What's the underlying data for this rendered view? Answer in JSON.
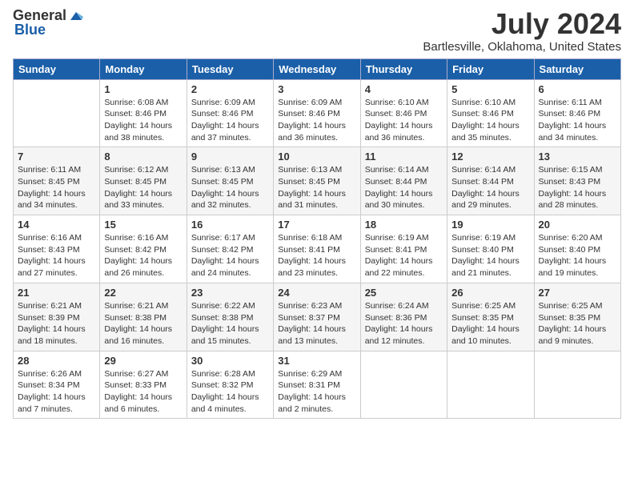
{
  "logo": {
    "general": "General",
    "blue": "Blue"
  },
  "title": {
    "month": "July 2024",
    "location": "Bartlesville, Oklahoma, United States"
  },
  "days_header": [
    "Sunday",
    "Monday",
    "Tuesday",
    "Wednesday",
    "Thursday",
    "Friday",
    "Saturday"
  ],
  "weeks": [
    [
      {
        "day": "",
        "sunrise": "",
        "sunset": "",
        "daylight": "",
        "empty": true
      },
      {
        "day": "1",
        "sunrise": "Sunrise: 6:08 AM",
        "sunset": "Sunset: 8:46 PM",
        "daylight": "Daylight: 14 hours and 38 minutes."
      },
      {
        "day": "2",
        "sunrise": "Sunrise: 6:09 AM",
        "sunset": "Sunset: 8:46 PM",
        "daylight": "Daylight: 14 hours and 37 minutes."
      },
      {
        "day": "3",
        "sunrise": "Sunrise: 6:09 AM",
        "sunset": "Sunset: 8:46 PM",
        "daylight": "Daylight: 14 hours and 36 minutes."
      },
      {
        "day": "4",
        "sunrise": "Sunrise: 6:10 AM",
        "sunset": "Sunset: 8:46 PM",
        "daylight": "Daylight: 14 hours and 36 minutes."
      },
      {
        "day": "5",
        "sunrise": "Sunrise: 6:10 AM",
        "sunset": "Sunset: 8:46 PM",
        "daylight": "Daylight: 14 hours and 35 minutes."
      },
      {
        "day": "6",
        "sunrise": "Sunrise: 6:11 AM",
        "sunset": "Sunset: 8:46 PM",
        "daylight": "Daylight: 14 hours and 34 minutes."
      }
    ],
    [
      {
        "day": "7",
        "sunrise": "Sunrise: 6:11 AM",
        "sunset": "Sunset: 8:45 PM",
        "daylight": "Daylight: 14 hours and 34 minutes."
      },
      {
        "day": "8",
        "sunrise": "Sunrise: 6:12 AM",
        "sunset": "Sunset: 8:45 PM",
        "daylight": "Daylight: 14 hours and 33 minutes."
      },
      {
        "day": "9",
        "sunrise": "Sunrise: 6:13 AM",
        "sunset": "Sunset: 8:45 PM",
        "daylight": "Daylight: 14 hours and 32 minutes."
      },
      {
        "day": "10",
        "sunrise": "Sunrise: 6:13 AM",
        "sunset": "Sunset: 8:45 PM",
        "daylight": "Daylight: 14 hours and 31 minutes."
      },
      {
        "day": "11",
        "sunrise": "Sunrise: 6:14 AM",
        "sunset": "Sunset: 8:44 PM",
        "daylight": "Daylight: 14 hours and 30 minutes."
      },
      {
        "day": "12",
        "sunrise": "Sunrise: 6:14 AM",
        "sunset": "Sunset: 8:44 PM",
        "daylight": "Daylight: 14 hours and 29 minutes."
      },
      {
        "day": "13",
        "sunrise": "Sunrise: 6:15 AM",
        "sunset": "Sunset: 8:43 PM",
        "daylight": "Daylight: 14 hours and 28 minutes."
      }
    ],
    [
      {
        "day": "14",
        "sunrise": "Sunrise: 6:16 AM",
        "sunset": "Sunset: 8:43 PM",
        "daylight": "Daylight: 14 hours and 27 minutes."
      },
      {
        "day": "15",
        "sunrise": "Sunrise: 6:16 AM",
        "sunset": "Sunset: 8:42 PM",
        "daylight": "Daylight: 14 hours and 26 minutes."
      },
      {
        "day": "16",
        "sunrise": "Sunrise: 6:17 AM",
        "sunset": "Sunset: 8:42 PM",
        "daylight": "Daylight: 14 hours and 24 minutes."
      },
      {
        "day": "17",
        "sunrise": "Sunrise: 6:18 AM",
        "sunset": "Sunset: 8:41 PM",
        "daylight": "Daylight: 14 hours and 23 minutes."
      },
      {
        "day": "18",
        "sunrise": "Sunrise: 6:19 AM",
        "sunset": "Sunset: 8:41 PM",
        "daylight": "Daylight: 14 hours and 22 minutes."
      },
      {
        "day": "19",
        "sunrise": "Sunrise: 6:19 AM",
        "sunset": "Sunset: 8:40 PM",
        "daylight": "Daylight: 14 hours and 21 minutes."
      },
      {
        "day": "20",
        "sunrise": "Sunrise: 6:20 AM",
        "sunset": "Sunset: 8:40 PM",
        "daylight": "Daylight: 14 hours and 19 minutes."
      }
    ],
    [
      {
        "day": "21",
        "sunrise": "Sunrise: 6:21 AM",
        "sunset": "Sunset: 8:39 PM",
        "daylight": "Daylight: 14 hours and 18 minutes."
      },
      {
        "day": "22",
        "sunrise": "Sunrise: 6:21 AM",
        "sunset": "Sunset: 8:38 PM",
        "daylight": "Daylight: 14 hours and 16 minutes."
      },
      {
        "day": "23",
        "sunrise": "Sunrise: 6:22 AM",
        "sunset": "Sunset: 8:38 PM",
        "daylight": "Daylight: 14 hours and 15 minutes."
      },
      {
        "day": "24",
        "sunrise": "Sunrise: 6:23 AM",
        "sunset": "Sunset: 8:37 PM",
        "daylight": "Daylight: 14 hours and 13 minutes."
      },
      {
        "day": "25",
        "sunrise": "Sunrise: 6:24 AM",
        "sunset": "Sunset: 8:36 PM",
        "daylight": "Daylight: 14 hours and 12 minutes."
      },
      {
        "day": "26",
        "sunrise": "Sunrise: 6:25 AM",
        "sunset": "Sunset: 8:35 PM",
        "daylight": "Daylight: 14 hours and 10 minutes."
      },
      {
        "day": "27",
        "sunrise": "Sunrise: 6:25 AM",
        "sunset": "Sunset: 8:35 PM",
        "daylight": "Daylight: 14 hours and 9 minutes."
      }
    ],
    [
      {
        "day": "28",
        "sunrise": "Sunrise: 6:26 AM",
        "sunset": "Sunset: 8:34 PM",
        "daylight": "Daylight: 14 hours and 7 minutes."
      },
      {
        "day": "29",
        "sunrise": "Sunrise: 6:27 AM",
        "sunset": "Sunset: 8:33 PM",
        "daylight": "Daylight: 14 hours and 6 minutes."
      },
      {
        "day": "30",
        "sunrise": "Sunrise: 6:28 AM",
        "sunset": "Sunset: 8:32 PM",
        "daylight": "Daylight: 14 hours and 4 minutes."
      },
      {
        "day": "31",
        "sunrise": "Sunrise: 6:29 AM",
        "sunset": "Sunset: 8:31 PM",
        "daylight": "Daylight: 14 hours and 2 minutes."
      },
      {
        "day": "",
        "sunrise": "",
        "sunset": "",
        "daylight": "",
        "empty": true
      },
      {
        "day": "",
        "sunrise": "",
        "sunset": "",
        "daylight": "",
        "empty": true
      },
      {
        "day": "",
        "sunrise": "",
        "sunset": "",
        "daylight": "",
        "empty": true
      }
    ]
  ]
}
